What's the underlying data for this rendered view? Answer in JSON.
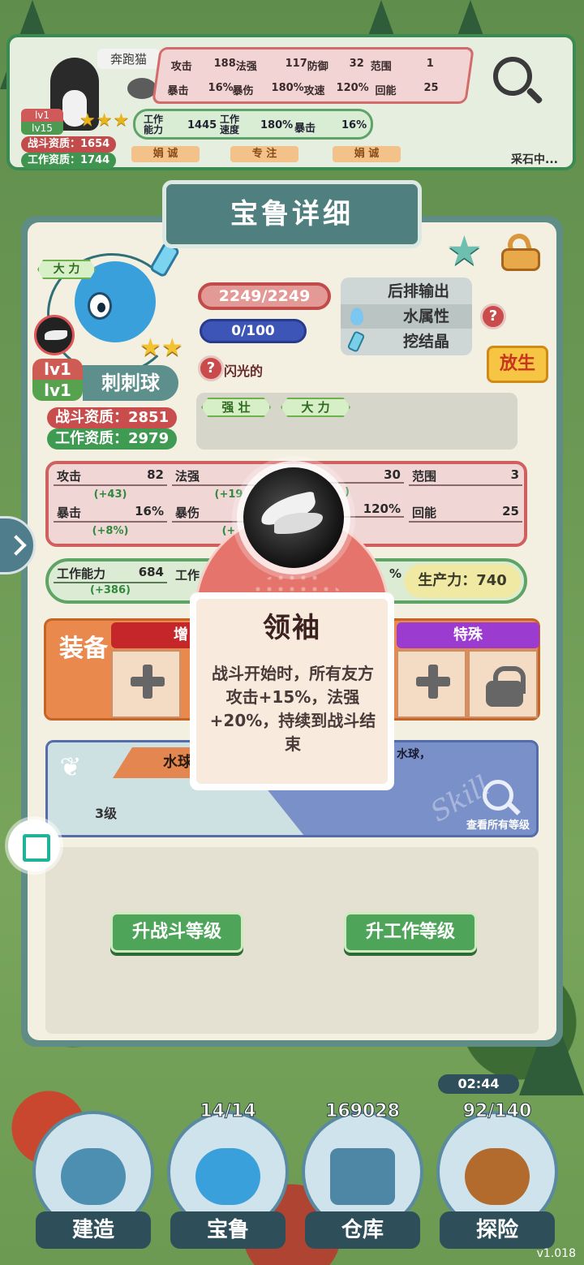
{
  "top_card": {
    "pet_name": "奔跑猫",
    "lv_battle": "lv1",
    "lv_work": "lv15",
    "battle_aptitude": "战斗资质：1654",
    "work_aptitude": "工作资质：1744",
    "stats_row1": [
      {
        "label": "攻击",
        "value": "188"
      },
      {
        "label": "法强",
        "value": "117"
      },
      {
        "label": "防御",
        "value": "32"
      },
      {
        "label": "范围",
        "value": "1"
      }
    ],
    "stats_row2": [
      {
        "label": "暴击",
        "value": "16%"
      },
      {
        "label": "暴伤",
        "value": "180%"
      },
      {
        "label": "攻速",
        "value": "120%"
      },
      {
        "label": "回能",
        "value": "25"
      }
    ],
    "work_stats": [
      {
        "label": "工作\n能力",
        "value": "1445"
      },
      {
        "label": "工作\n速度",
        "value": "180%"
      },
      {
        "label": "暴击",
        "value": "16%"
      }
    ],
    "traits": [
      "娟 诚",
      "专 注",
      "娟 诚"
    ],
    "status": "采石中..."
  },
  "panel": {
    "title": "宝鲁详细",
    "trait_top": "大 力",
    "lv_battle": "lv1",
    "lv_work": "lv1",
    "name": "刺刺球",
    "battle_aptitude": "战斗资质：2851",
    "work_aptitude": "工作资质：2979",
    "hp": "2249/2249",
    "mp": "0/100",
    "attributes": [
      "后排输出",
      "水属性",
      "挖结晶"
    ],
    "help_mark": "?",
    "release_label": "放生",
    "flash_label": "闪光的",
    "traits": [
      "强 壮",
      "大 力"
    ],
    "combat_stats": [
      {
        "label": "攻击",
        "value": "82",
        "bonus": "(+43)"
      },
      {
        "label": "法强",
        "value": "",
        "bonus": "(+19"
      },
      {
        "label": "",
        "value": "30",
        "bonus": ")"
      },
      {
        "label": "范围",
        "value": "3",
        "bonus": ""
      },
      {
        "label": "暴击",
        "value": "16%",
        "bonus": "(+8%)"
      },
      {
        "label": "暴伤",
        "value": "",
        "bonus": "(+"
      },
      {
        "label": "",
        "value": "120%",
        "bonus": ""
      },
      {
        "label": "回能",
        "value": "25",
        "bonus": ""
      }
    ],
    "work_stat": {
      "label": "工作能力",
      "value": "684",
      "bonus": "(+386)"
    },
    "work_stat2_label": "工作",
    "work_stat_pct": "%",
    "productivity": "生产力：740",
    "equip_label": "装备",
    "equip_head_left": "增",
    "equip_head_right": "特殊",
    "skill": {
      "name": "水球",
      "level": "3级",
      "desc": "水球，",
      "watermark": "Skill",
      "view_all": "查看所有等级"
    },
    "btn_battle_level": "升战斗等级",
    "btn_work_level": "升工作等级"
  },
  "popup": {
    "title": "领袖",
    "description": "战斗开始时，所有友方攻击+15%，法强+20%，持续到战斗结束"
  },
  "nav": [
    {
      "label": "建造",
      "count": ""
    },
    {
      "label": "宝鲁",
      "count": "14/14"
    },
    {
      "label": "仓库",
      "count": "169028"
    },
    {
      "label": "探险",
      "count": "92/140"
    }
  ],
  "timer": "02:44",
  "version": "v1.018",
  "colors": {
    "panel_teal": "#5f8d86",
    "accent_red": "#c94d4d",
    "accent_green": "#4ea55a",
    "equip_orange": "#e9894e",
    "special_purple": "#9b3bd0",
    "popup_red": "#e5756c"
  }
}
